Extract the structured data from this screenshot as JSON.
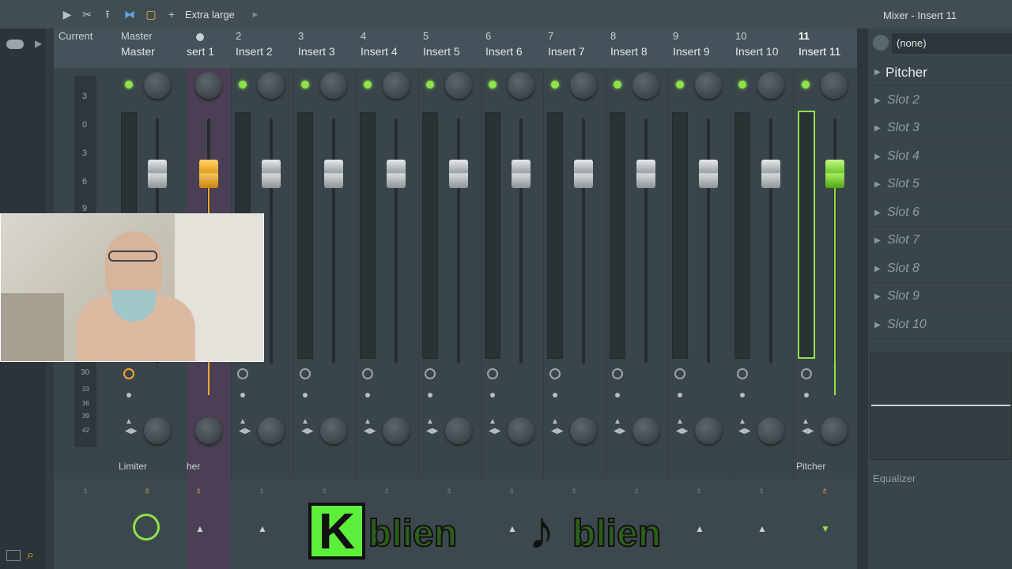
{
  "toolbar": {
    "size_label": "Extra large",
    "window_title": "Mixer - Insert 11"
  },
  "header": {
    "current_label": "Current",
    "tracks": [
      {
        "num": "Master",
        "name": "Master"
      },
      {
        "num": "",
        "name": "sert 1"
      },
      {
        "num": "2",
        "name": "Insert 2"
      },
      {
        "num": "3",
        "name": "Insert 3"
      },
      {
        "num": "4",
        "name": "Insert 4"
      },
      {
        "num": "5",
        "name": "Insert 5"
      },
      {
        "num": "6",
        "name": "Insert 6"
      },
      {
        "num": "7",
        "name": "Insert 7"
      },
      {
        "num": "8",
        "name": "Insert 8"
      },
      {
        "num": "9",
        "name": "Insert 9"
      },
      {
        "num": "10",
        "name": "Insert 10"
      },
      {
        "num": "11",
        "name": "Insert 11"
      }
    ]
  },
  "scale": {
    "labels": [
      "3",
      "0",
      "3",
      "6",
      "9",
      "30",
      "33",
      "36",
      "39",
      "42"
    ]
  },
  "bottom": {
    "fx_labels": {
      "master": "Limiter",
      "insert1": "her",
      "insert11": "Pitcher"
    }
  },
  "right_panel": {
    "route_value": "(none)",
    "slots": [
      "Pitcher",
      "Slot 2",
      "Slot 3",
      "Slot 4",
      "Slot 5",
      "Slot 6",
      "Slot 7",
      "Slot 8",
      "Slot 9",
      "Slot 10"
    ],
    "eq_label": "Equalizer"
  },
  "watermark": {
    "text1": "blien",
    "text2": "blien",
    "k": "K"
  },
  "colors": {
    "accent_green": "#8ee24a",
    "accent_orange": "#f0a631",
    "selected_strip": "#4a3f54"
  }
}
